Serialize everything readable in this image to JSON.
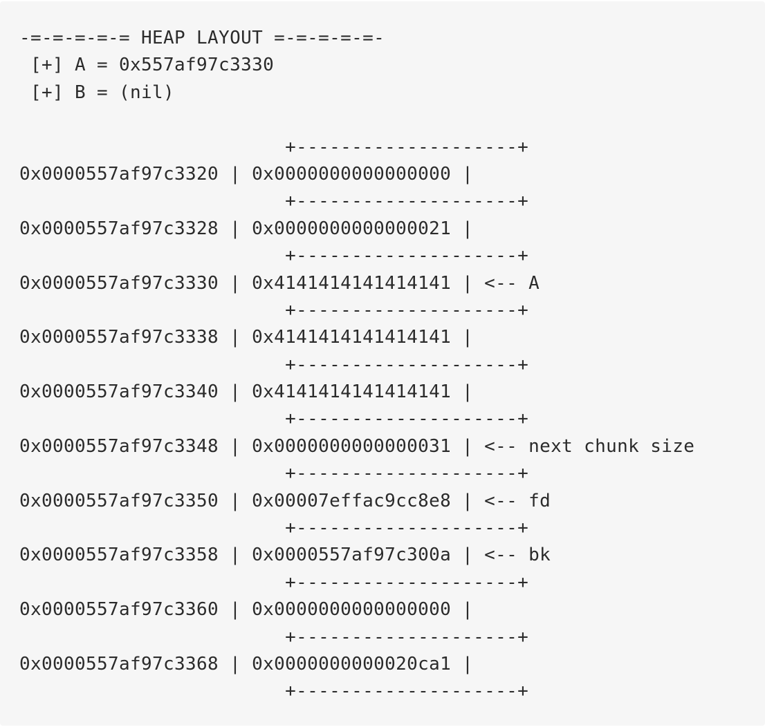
{
  "header": {
    "title": "-=-=-=-=-= HEAP LAYOUT =-=-=-=-=-",
    "pointers": [
      " [+] A = 0x557af97c3330",
      " [+] B = (nil)"
    ]
  },
  "diagram": {
    "border": "                        +--------------------+",
    "rows": [
      {
        "text": "0x0000557af97c3320 | 0x0000000000000000 |"
      },
      {
        "text": "0x0000557af97c3328 | 0x0000000000000021 |"
      },
      {
        "text": "0x0000557af97c3330 | 0x4141414141414141 | <-- A"
      },
      {
        "text": "0x0000557af97c3338 | 0x4141414141414141 |"
      },
      {
        "text": "0x0000557af97c3340 | 0x4141414141414141 |"
      },
      {
        "text": "0x0000557af97c3348 | 0x0000000000000031 | <-- next chunk size"
      },
      {
        "text": "0x0000557af97c3350 | 0x00007effac9cc8e8 | <-- fd"
      },
      {
        "text": "0x0000557af97c3358 | 0x0000557af97c300a | <-- bk"
      },
      {
        "text": "0x0000557af97c3360 | 0x0000000000000000 |"
      },
      {
        "text": "0x0000557af97c3368 | 0x0000000000020ca1 |"
      }
    ]
  }
}
